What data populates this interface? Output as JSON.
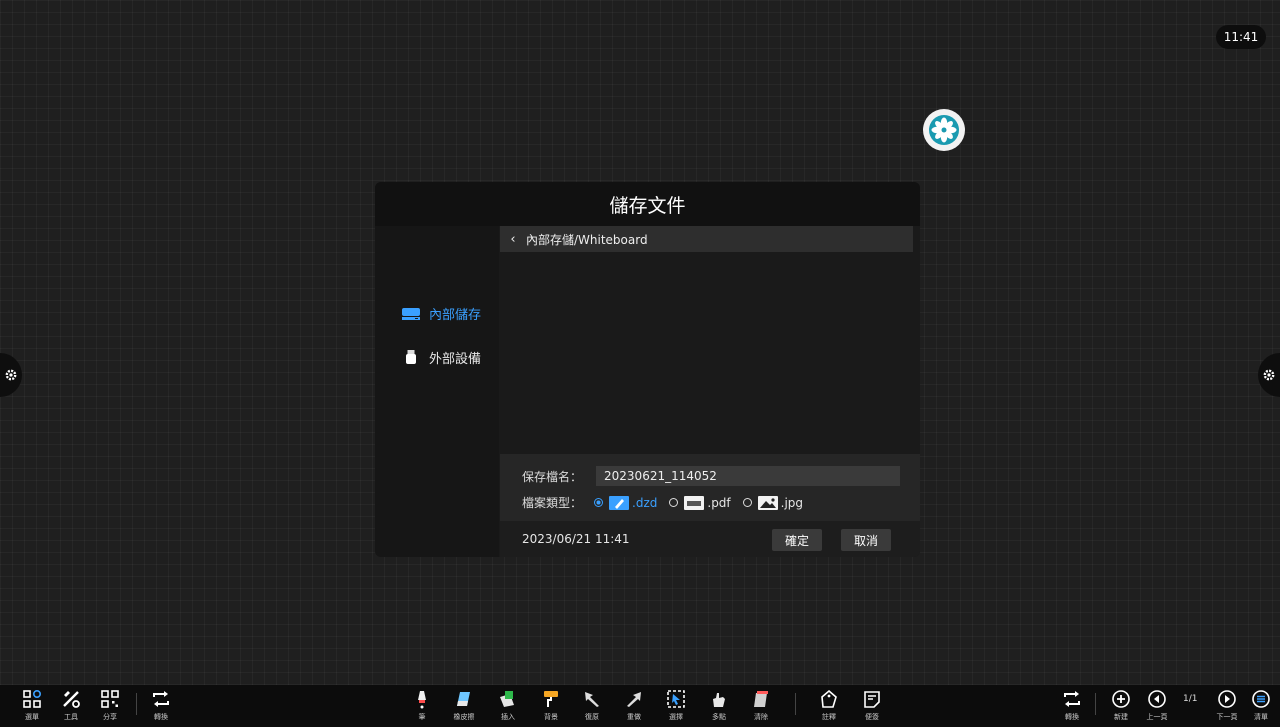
{
  "clock": "11:41",
  "dialog": {
    "title": "儲存文件",
    "sidebar": [
      {
        "label": "內部儲存",
        "icon": "drive-icon",
        "active": true
      },
      {
        "label": "外部設備",
        "icon": "usb-icon",
        "active": false
      }
    ],
    "path": "內部存儲/Whiteboard",
    "filename_label": "保存檔名：",
    "filename_value": "20230621_114052",
    "filetype_label": "檔案類型：",
    "filetypes": [
      ".dzd",
      ".pdf",
      ".jpg"
    ],
    "selected_filetype": ".dzd",
    "date": "2023/06/21 11:41",
    "ok_label": "確定",
    "cancel_label": "取消"
  },
  "toolbar": {
    "left": [
      {
        "label": "選單",
        "icon": "menu-grid-icon"
      },
      {
        "label": "工具",
        "icon": "tools-icon"
      },
      {
        "label": "分享",
        "icon": "qr-share-icon"
      },
      {
        "label": "轉換",
        "icon": "switch-icon"
      }
    ],
    "center": [
      {
        "label": "筆",
        "icon": "pen-icon"
      },
      {
        "label": "橡皮擦",
        "icon": "eraser-icon"
      },
      {
        "label": "插入",
        "icon": "insert-icon"
      },
      {
        "label": "背景",
        "icon": "background-icon"
      },
      {
        "label": "復原",
        "icon": "undo-icon"
      },
      {
        "label": "重做",
        "icon": "redo-icon"
      },
      {
        "label": "選擇",
        "icon": "select-icon"
      },
      {
        "label": "多點",
        "icon": "multitouch-icon"
      },
      {
        "label": "清除",
        "icon": "clear-icon"
      },
      {
        "label": "註釋",
        "icon": "annotate-icon"
      },
      {
        "label": "便簽",
        "icon": "sticky-note-icon"
      }
    ],
    "right": [
      {
        "label": "轉換",
        "icon": "switch-icon"
      },
      {
        "label": "新建",
        "icon": "new-page-icon"
      },
      {
        "label": "上一頁",
        "icon": "prev-page-icon"
      },
      {
        "label": "下一頁",
        "icon": "next-page-icon"
      },
      {
        "label": "清單",
        "icon": "list-icon"
      }
    ],
    "page_indicator": "1/1"
  },
  "colors": {
    "accent": "#3aa0ff",
    "background": "#1f1f1f",
    "dialog": "#1a1a1a"
  }
}
